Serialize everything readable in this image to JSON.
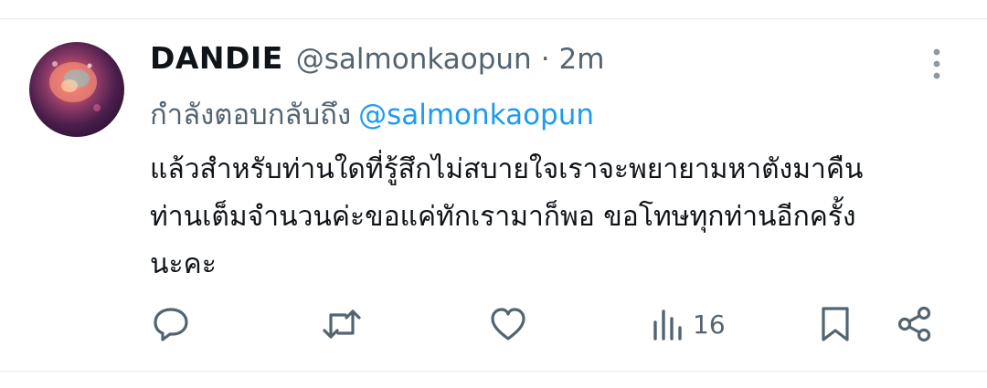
{
  "author": {
    "display_name": "DANDIE",
    "handle": "@salmonkaopun",
    "separator": "·",
    "time": "2m"
  },
  "reply_context": {
    "prefix": "กำลังตอบกลับถึง",
    "mention": "@salmonkaopun"
  },
  "tweet": {
    "lines": [
      "แล้วสำหรับท่านใดที่รู้สึกไม่สบายใจเราจะพยายามหาตังมาคืน",
      "ท่านเต็มจำนวนค่ะขอแค่ทักเรามาก็พอ ขอโทษทุกท่านอีกครั้ง",
      "นะคะ"
    ]
  },
  "actions": {
    "reply_icon": "reply-icon",
    "retweet_icon": "retweet-icon",
    "like_icon": "heart-icon",
    "views_icon": "views-bar-icon",
    "views_count": "16",
    "bookmark_icon": "bookmark-icon",
    "share_icon": "share-icon"
  },
  "colors": {
    "text_primary": "#0f1419",
    "text_secondary": "#536471",
    "link": "#1d9bf0",
    "divider": "#e6e9ec"
  }
}
